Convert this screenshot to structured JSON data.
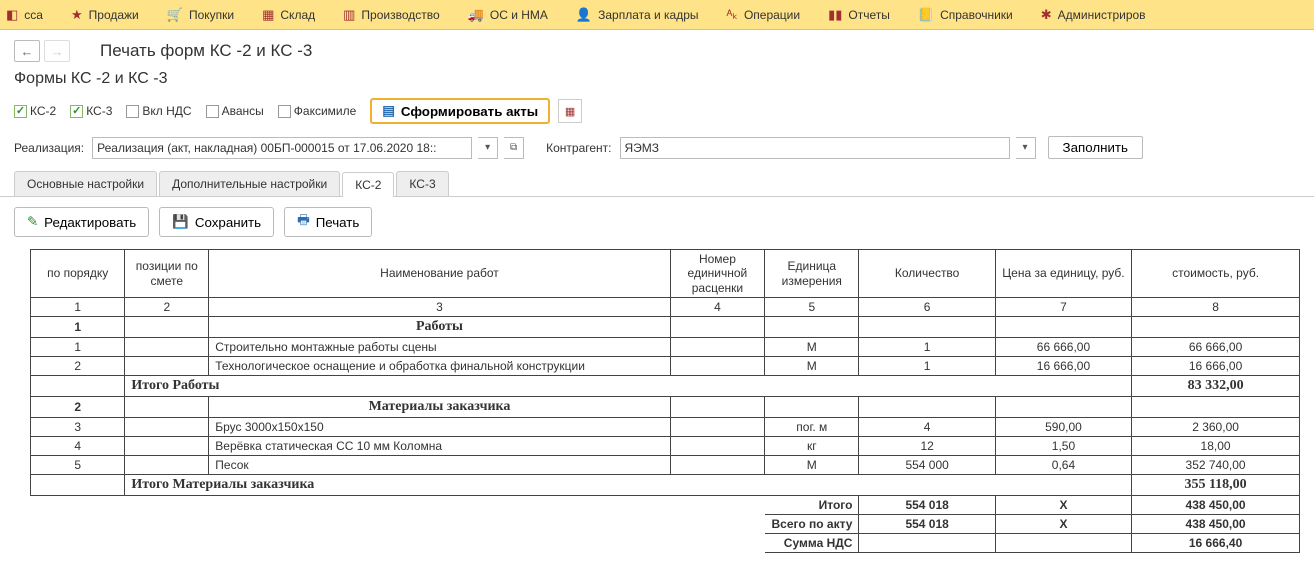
{
  "nav": {
    "items": [
      {
        "icon": "◧",
        "label": "сса"
      },
      {
        "icon": "★",
        "label": "Продажи"
      },
      {
        "icon": "🛒",
        "label": "Покупки"
      },
      {
        "icon": "▦",
        "label": "Склад"
      },
      {
        "icon": "▥",
        "label": "Производство"
      },
      {
        "icon": "🚚",
        "label": "ОС и НМА"
      },
      {
        "icon": "👤",
        "label": "Зарплата и кадры"
      },
      {
        "icon": "ᴬₖ",
        "label": "Операции"
      },
      {
        "icon": "▮▮",
        "label": "Отчеты"
      },
      {
        "icon": "📒",
        "label": "Справочники"
      },
      {
        "icon": "✱",
        "label": "Администриров"
      }
    ]
  },
  "title": "Печать форм КС -2 и КС -3",
  "subheader": "Формы КС -2 и КС -3",
  "checks": {
    "ks2": {
      "label": "КС-2",
      "checked": true
    },
    "ks3": {
      "label": "КС-3",
      "checked": true
    },
    "vklnds": {
      "label": "Вкл НДС",
      "checked": false
    },
    "avansy": {
      "label": "Авансы",
      "checked": false
    },
    "faksimile": {
      "label": "Факсимиле",
      "checked": false
    }
  },
  "form_button": "Сформировать акты",
  "realization": {
    "label": "Реализация:",
    "value": "Реализация (акт, накладная) 00БП-000015 от 17.06.2020 18::"
  },
  "contragent": {
    "label": "Контрагент:",
    "value": "ЯЭМЗ"
  },
  "fill_btn": "Заполнить",
  "tabs": {
    "t0": "Основные настройки",
    "t1": "Дополнительные настройки",
    "t2": "КС-2",
    "t3": "КС-3"
  },
  "toolbar": {
    "edit": "Редактировать",
    "save": "Сохранить",
    "print": "Печать"
  },
  "headers": {
    "c1": "по порядку",
    "c2": "позиции по смете",
    "c3": "Наименование работ",
    "c4": "Номер единичной расценки",
    "c5": "Единица измерения",
    "c6": "Количество",
    "c7": "Цена за единицу, руб.",
    "c8": "стоимость, руб."
  },
  "numrow": {
    "c1": "1",
    "c2": "2",
    "c3": "3",
    "c4": "4",
    "c5": "5",
    "c6": "6",
    "c7": "7",
    "c8": "8"
  },
  "section1": {
    "num": "1",
    "name": "Работы"
  },
  "rows1": [
    {
      "n": "1",
      "name": "Строительно монтажные работы сцены",
      "unit": "М",
      "qty": "1",
      "price": "66 666,00",
      "cost": "66 666,00"
    },
    {
      "n": "2",
      "name": "Технологическое оснащение и обработка финальной конструкции",
      "unit": "М",
      "qty": "1",
      "price": "16 666,00",
      "cost": "16 666,00"
    }
  ],
  "total1": {
    "label": "Итого Работы",
    "cost": "83 332,00"
  },
  "section2": {
    "num": "2",
    "name": "Материалы заказчика"
  },
  "rows2": [
    {
      "n": "3",
      "name": "Брус 3000х150х150",
      "unit": "пог. м",
      "qty": "4",
      "price": "590,00",
      "cost": "2 360,00"
    },
    {
      "n": "4",
      "name": "Верёвка статическая СС 10 мм Коломна",
      "unit": "кг",
      "qty": "12",
      "price": "1,50",
      "cost": "18,00"
    },
    {
      "n": "5",
      "name": "Песок",
      "unit": "М",
      "qty": "554 000",
      "price": "0,64",
      "cost": "352 740,00"
    }
  ],
  "total2": {
    "label": "Итого Материалы заказчика",
    "cost": "355 118,00"
  },
  "summary": {
    "itogo": {
      "label": "Итого",
      "qty": "554 018",
      "price": "X",
      "cost": "438 450,00"
    },
    "vsego": {
      "label": "Всего по акту",
      "qty": "554 018",
      "price": "X",
      "cost": "438 450,00"
    },
    "nds": {
      "label": "Сумма НДС",
      "cost": "16 666,40"
    }
  }
}
